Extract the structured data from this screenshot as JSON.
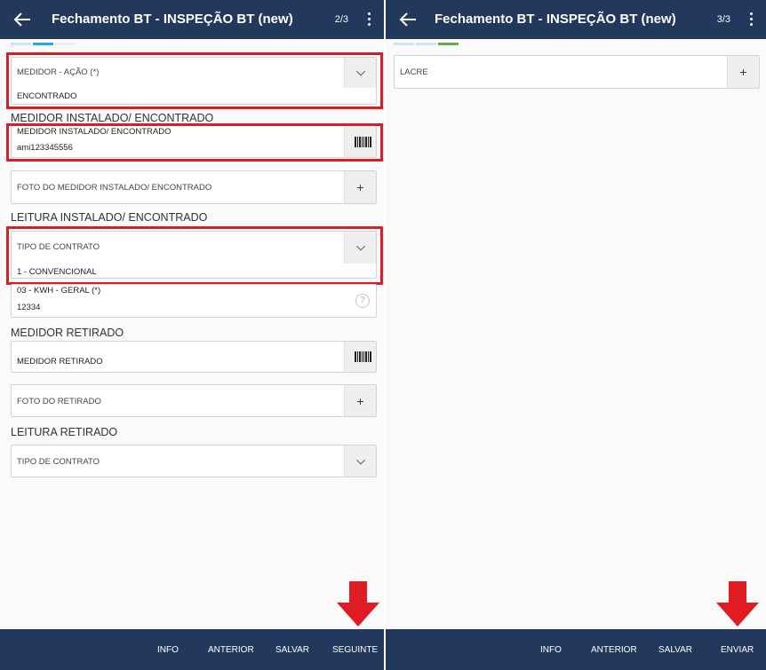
{
  "colors": {
    "appbar": "#22385c",
    "highlight": "#e11b22",
    "step_done": "#cfe4ee",
    "step_active_p1": "#2aa7d8",
    "step_active_p2": "#6aa84f"
  },
  "screen1": {
    "title": "Fechamento BT - INSPEÇÃO BT (new)",
    "pager": "2/3",
    "fields": {
      "medidor_acao": {
        "label": "MEDIDOR - AÇÃO (*)",
        "value": "ENCONTRADO"
      },
      "medidor_instalado": {
        "label": "MEDIDOR INSTALADO/ ENCONTRADO",
        "value": "ami123345556"
      },
      "foto_instalado": {
        "label": "FOTO DO MEDIDOR INSTALADO/ ENCONTRADO"
      },
      "tipo_contrato_1": {
        "label": "TIPO DE CONTRATO",
        "value": "1 - CONVENCIONAL"
      },
      "kwh_geral": {
        "label": "03 - KWH - GERAL (*)",
        "value": "12334"
      },
      "medidor_retirado": {
        "label": "MEDIDOR RETIRADO"
      },
      "foto_retirado": {
        "label": "FOTO DO RETIRADO"
      },
      "tipo_contrato_2": {
        "label": "TIPO DE CONTRATO"
      }
    },
    "sections": {
      "medidor_instalado": "MEDIDOR INSTALADO/ ENCONTRADO",
      "leitura_instalado": "LEITURA INSTALADO/ ENCONTRADO",
      "medidor_retirado": "MEDIDOR RETIRADO",
      "leitura_retirado": "LEITURA RETIRADO"
    },
    "bottom": {
      "info": "INFO",
      "anterior": "ANTERIOR",
      "salvar": "SALVAR",
      "seguinte": "SEGUINTE"
    }
  },
  "screen2": {
    "title": "Fechamento BT - INSPEÇÃO BT (new)",
    "pager": "3/3",
    "fields": {
      "lacre": {
        "label": "LACRE"
      }
    },
    "bottom": {
      "info": "INFO",
      "anterior": "ANTERIOR",
      "salvar": "SALVAR",
      "enviar": "ENVIAR"
    }
  },
  "icons": {
    "back": "arrow-left",
    "menu": "more-vertical",
    "plus": "plus",
    "chevron": "chevron-down",
    "barcode": "barcode",
    "help": "question-circle",
    "annotation_arrow": "arrow-down"
  }
}
